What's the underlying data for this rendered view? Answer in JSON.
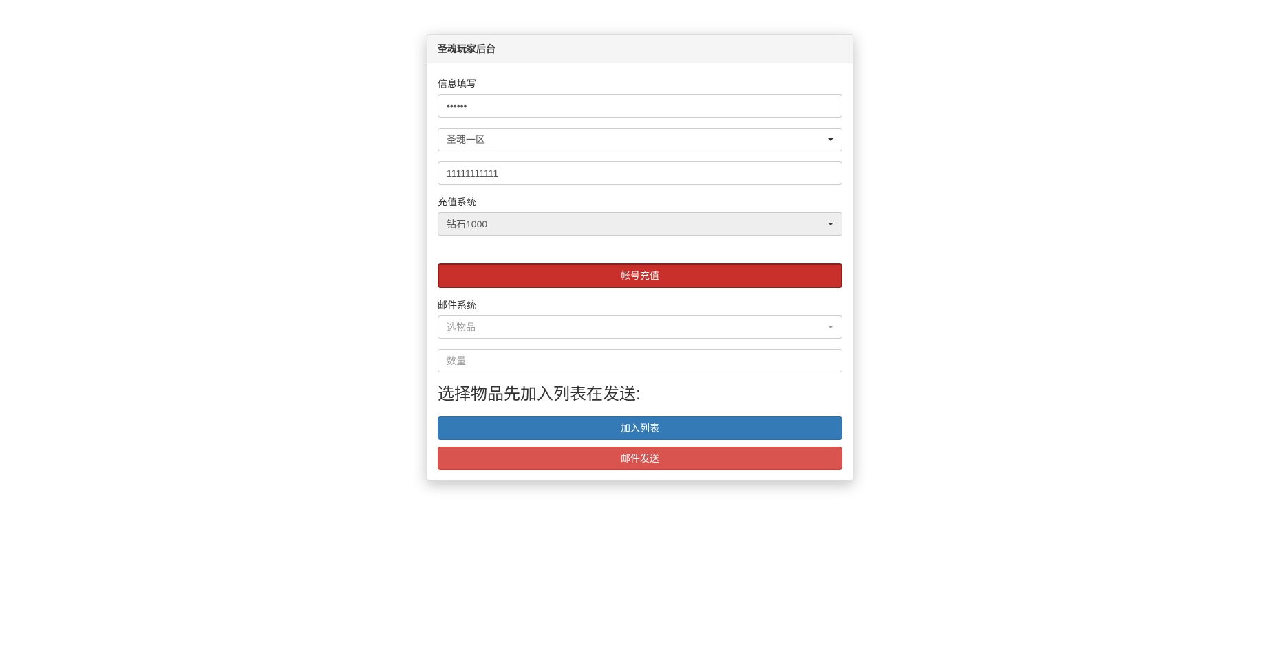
{
  "panel": {
    "title": "圣魂玩家后台"
  },
  "info_section": {
    "label": "信息填写",
    "password_value": "••••••",
    "server_selected": "圣魂一区",
    "account_value": "11111111111"
  },
  "recharge_section": {
    "label": "充值系统",
    "package_selected": "钻石1000",
    "submit_button": "帐号充值"
  },
  "mail_section": {
    "label": "邮件系统",
    "item_placeholder": "选物品",
    "quantity_placeholder": "数量",
    "list_heading": "选择物品先加入列表在发送:",
    "add_button": "加入列表",
    "send_button": "邮件发送"
  }
}
